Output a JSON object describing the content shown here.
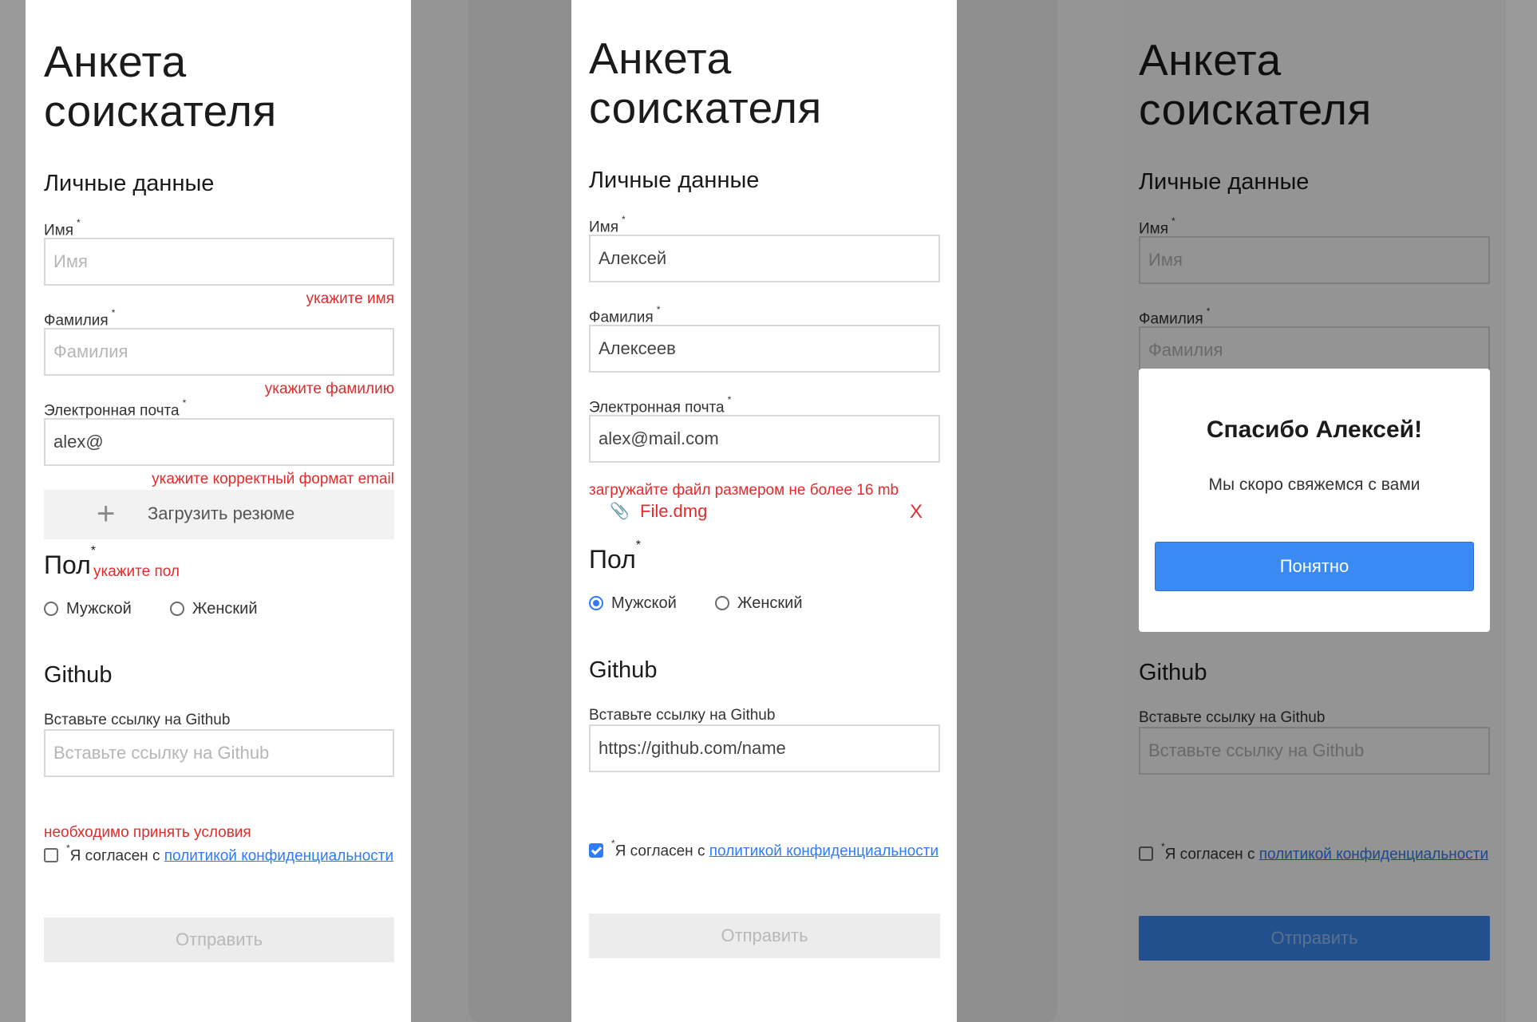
{
  "form": {
    "title_line1": "Анкета",
    "title_line2": "соискателя",
    "personal_section": "Личные данные",
    "name_label": "Имя",
    "surname_label": "Фамилия",
    "email_label": "Электронная почта",
    "required_mark": "*",
    "name_placeholder": "Имя",
    "surname_placeholder": "Фамилия",
    "upload_label": "Загрузить резюме",
    "sex_title": "Пол",
    "sex_male": "Мужской",
    "sex_female": "Женский",
    "github_section": "Github",
    "github_label": "Вставьте ссылку на Github",
    "github_placeholder": "Вставьте ссылку на Github",
    "agree_prefix": "Я согласен с ",
    "agree_link": "политикой конфиденциальности",
    "submit_label": "Отправить"
  },
  "panel_errors": {
    "email_value": "alex@",
    "err_name": "укажите имя",
    "err_surname": "укажите фамилию",
    "err_email": "укажите корректный формат email",
    "err_sex": "укажите пол",
    "err_terms": "необходимо принять условия"
  },
  "panel_filled": {
    "name_value": "Алексей",
    "surname_value": "Алексеев",
    "email_value": "alex@mail.com",
    "err_file": "загружайте файл размером не более 16 mb",
    "file_name": "File.dmg",
    "file_remove": "X",
    "github_value": "https://github.com/name",
    "selected_sex": "Мужской",
    "agree_checked": true
  },
  "panel_success": {
    "modal_title": "Спасибо Алексей!",
    "modal_text": "Мы скоро свяжемся с вами",
    "modal_button": "Понятно"
  },
  "colors": {
    "accent": "#2f7cf6",
    "error": "#e02c2c",
    "backdrop": "#959595"
  },
  "icons": {
    "plus": "plus-icon",
    "clip": "paperclip-icon"
  }
}
